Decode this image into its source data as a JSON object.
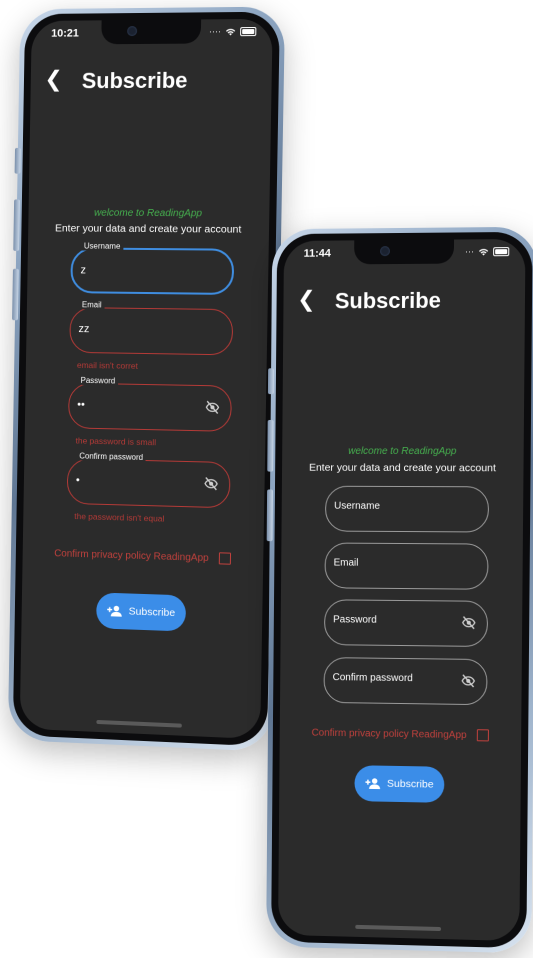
{
  "back_phone": {
    "status_time": "10:21",
    "title": "Subscribe",
    "welcome": "welcome to ReadingApp",
    "subtitle": "Enter your data and create your account",
    "username": {
      "label": "Username",
      "value": "z"
    },
    "email": {
      "label": "Email",
      "value": "zz",
      "error": "email isn't corret"
    },
    "password": {
      "label": "Password",
      "value": "••",
      "error": "the password is small"
    },
    "confirm_password": {
      "label": "Confirm password",
      "value": "•",
      "error": "the password isn't equal"
    },
    "privacy": "Confirm privacy policy ReadingApp",
    "button": "Subscribe"
  },
  "front_phone": {
    "status_time": "11:44",
    "title": "Subscribe",
    "welcome": "welcome to ReadingApp",
    "subtitle": "Enter your data and create your account",
    "username_placeholder": "Username",
    "email_placeholder": "Email",
    "password_placeholder": "Password",
    "confirm_password_placeholder": "Confirm password",
    "privacy": "Confirm privacy policy ReadingApp",
    "button": "Subscribe"
  },
  "icons": {
    "back": "chevron-left-icon",
    "visibility": "eye-off-icon",
    "subscribe": "person-add-icon",
    "wifi": "wifi-icon",
    "battery": "battery-icon"
  },
  "colors": {
    "screen_bg": "#2b2b2b",
    "welcome_green": "#46b04f",
    "error_red": "#b43a37",
    "focus_blue": "#3f8de0",
    "button_blue": "#3b8de8"
  }
}
